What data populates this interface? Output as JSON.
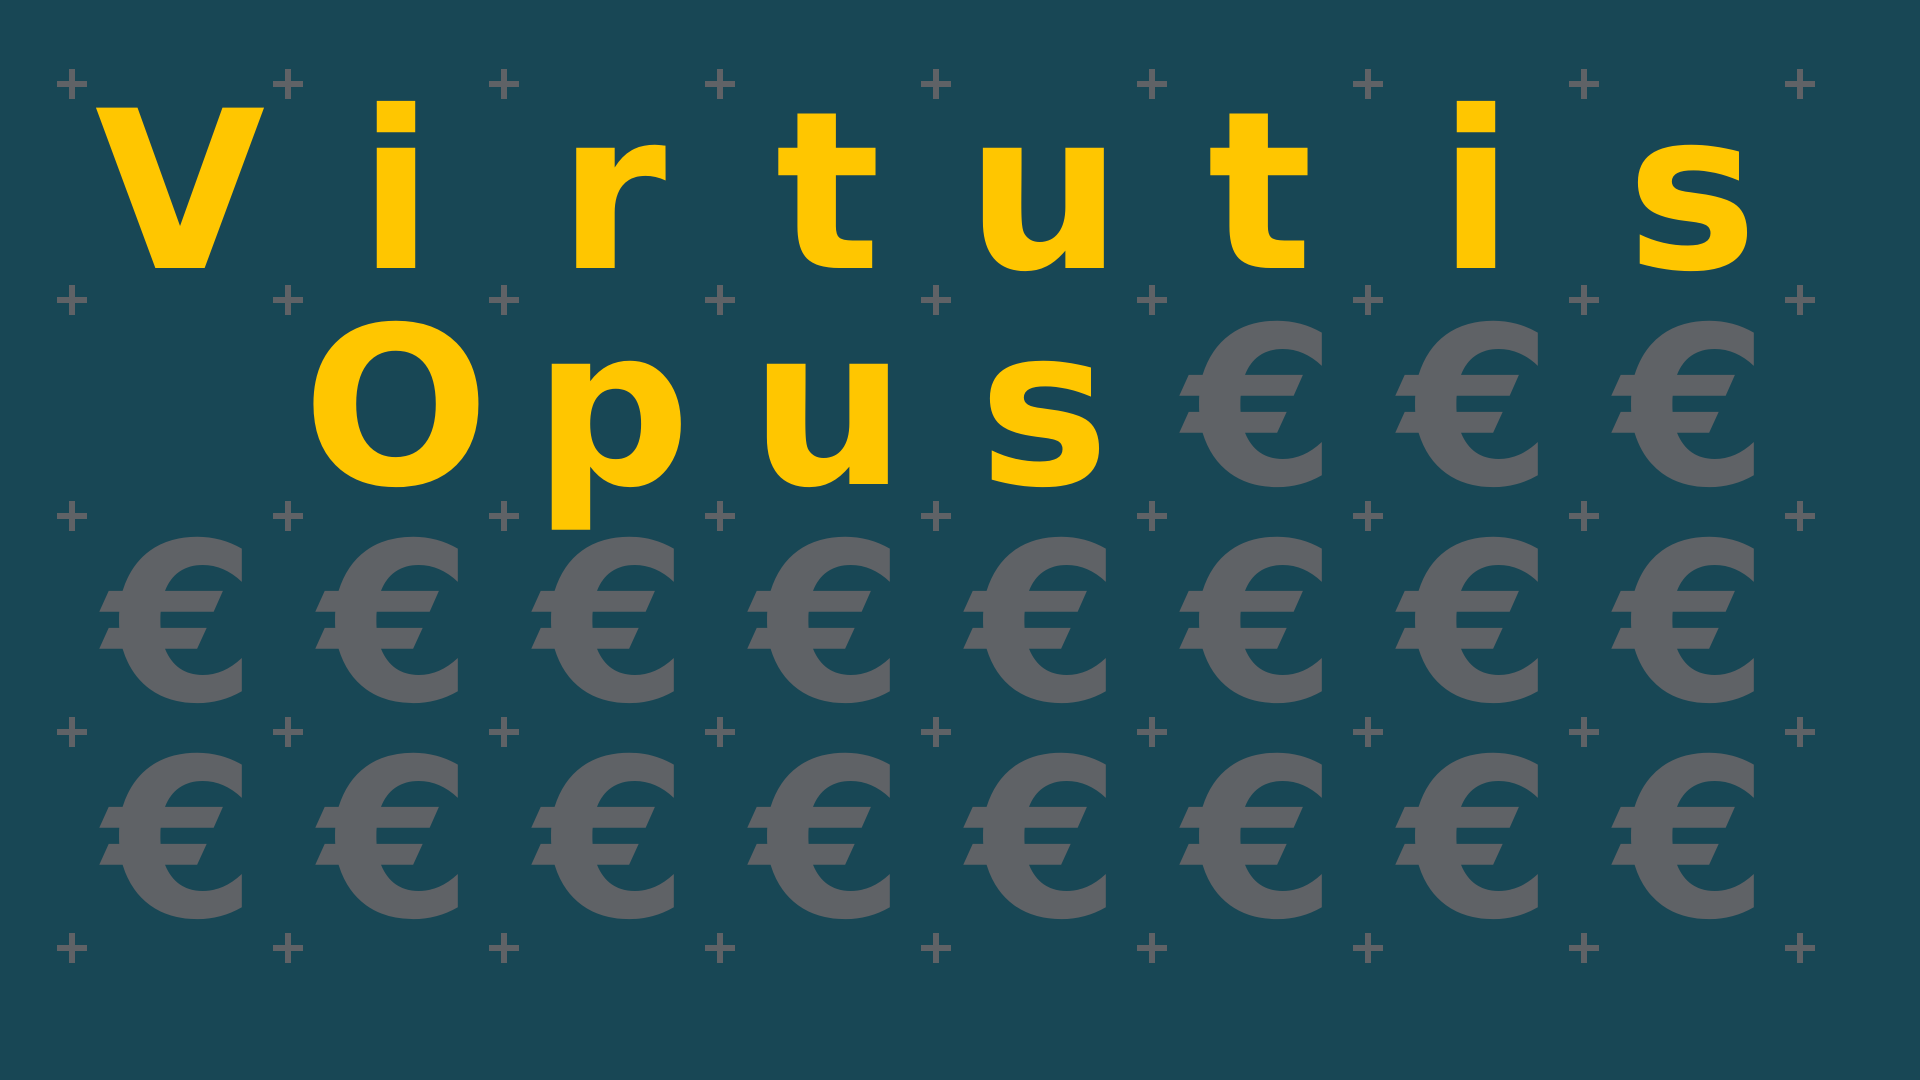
{
  "colors": {
    "background": "#184755",
    "letter": "#ffc600",
    "euro": "#5f6266",
    "plus": "#5f6266"
  },
  "grid": {
    "columns": 8,
    "rows": 4,
    "cells": [
      [
        "V",
        "i",
        "r",
        "t",
        "u",
        "t",
        "i",
        "s"
      ],
      [
        "",
        "O",
        "p",
        "u",
        "s",
        "€",
        "€",
        "€"
      ],
      [
        "€",
        "€",
        "€",
        "€",
        "€",
        "€",
        "€",
        "€"
      ],
      [
        "€",
        "€",
        "€",
        "€",
        "€",
        "€",
        "€",
        "€"
      ]
    ]
  },
  "euro_symbol": "€"
}
